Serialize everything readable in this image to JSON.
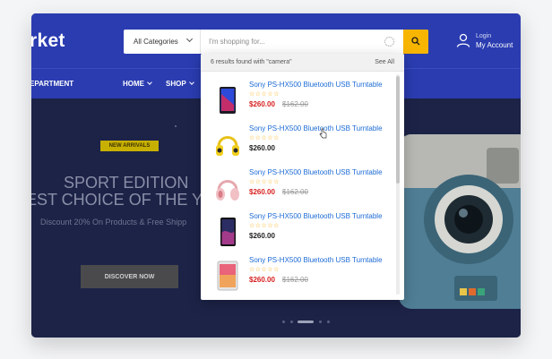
{
  "header": {
    "logo": "rket",
    "search": {
      "category": "All Categories",
      "placeholder": "I'm shopping for..."
    },
    "login": {
      "label": "Login",
      "account": "My Account"
    }
  },
  "nav": {
    "department": "EPARTMENT",
    "items": [
      {
        "label": "HOME"
      },
      {
        "label": "SHOP"
      }
    ]
  },
  "hero": {
    "badge": "NEW ARRIVALS",
    "title_line1": "SPORT EDITION",
    "title_line2": "EST CHOICE OF THE Y",
    "subtitle": "Discount 20% On Products & Free Shipp",
    "cta": "DISCOVER NOW"
  },
  "dropdown": {
    "results_text": "6 results found with \"camera\"",
    "see_all": "See All",
    "items": [
      {
        "name": "Sony PS-HX500 Bluetooth USB Turntable",
        "stars": "☆☆☆☆☆",
        "price": "$260.00",
        "old_price": "$162.00",
        "on_sale": true,
        "thumb": "phone-icon"
      },
      {
        "name": "Sony PS-HX500 Bluetooth USB Turntable",
        "stars": "☆☆☆☆☆",
        "price": "$260.00",
        "old_price": "",
        "on_sale": false,
        "thumb": "yellow-headphones-icon"
      },
      {
        "name": "Sony PS-HX500 Bluetooth USB Turntable",
        "stars": "☆☆☆☆☆",
        "price": "$260.00",
        "old_price": "$162.00",
        "on_sale": true,
        "thumb": "pink-headphones-icon"
      },
      {
        "name": "Sony PS-HX500 Bluetooth USB Turntable",
        "stars": "☆☆☆☆☆",
        "price": "$260.00",
        "old_price": "",
        "on_sale": false,
        "thumb": "smartphone-icon"
      },
      {
        "name": "Sony PS-HX500 Bluetooth USB Turntable",
        "stars": "☆☆☆☆☆",
        "price": "$260.00",
        "old_price": "$162.00",
        "on_sale": true,
        "thumb": "tablet-icon"
      }
    ]
  },
  "colors": {
    "header_bg": "#2a3cb0",
    "accent": "#f7b500",
    "link": "#1c6bd6",
    "sale": "#d72020"
  }
}
